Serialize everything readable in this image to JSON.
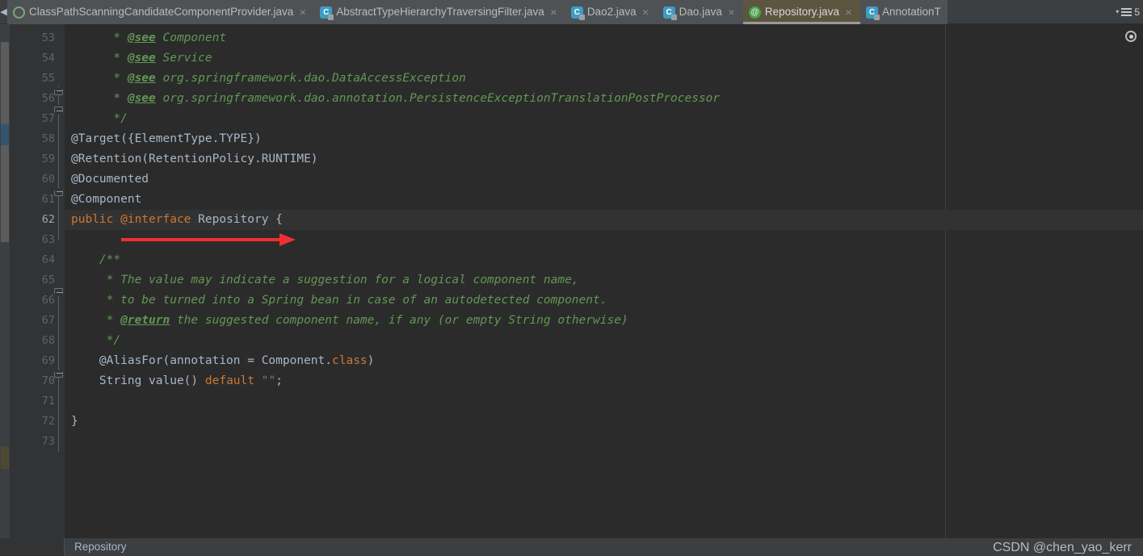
{
  "tabbar": {
    "scroll_left_icon": "chevron-left-icon",
    "tabs": [
      {
        "label": "ClassPathScanningCandidateComponentProvider.java",
        "icon": "class-file-icon",
        "icon_glyph": "",
        "close": "×",
        "active": false
      },
      {
        "label": "AbstractTypeHierarchyTraversingFilter.java",
        "icon": "class-file-icon",
        "icon_glyph": "C",
        "close": "×",
        "active": false
      },
      {
        "label": "Dao2.java",
        "icon": "class-file-icon",
        "icon_glyph": "C",
        "close": "×",
        "active": false
      },
      {
        "label": "Dao.java",
        "icon": "class-file-icon",
        "icon_glyph": "C",
        "close": "×",
        "active": false
      },
      {
        "label": "Repository.java",
        "icon": "annotation-file-icon",
        "icon_glyph": "@",
        "close": "×",
        "active": true
      },
      {
        "label": "AnnotationT",
        "icon": "class-file-icon",
        "icon_glyph": "C",
        "close": "",
        "active": false
      }
    ],
    "overflow": {
      "chevron": "▾",
      "count": "5"
    }
  },
  "editor": {
    "lines": [
      {
        "no": "53",
        "segs": [
          {
            "t": "      * ",
            "c": "c-doc"
          },
          {
            "t": "@see",
            "c": "c-tag"
          },
          {
            "t": " Component",
            "c": "c-doc"
          }
        ]
      },
      {
        "no": "54",
        "segs": [
          {
            "t": "      * ",
            "c": "c-doc"
          },
          {
            "t": "@see",
            "c": "c-tag"
          },
          {
            "t": " Service",
            "c": "c-doc"
          }
        ]
      },
      {
        "no": "55",
        "segs": [
          {
            "t": "      * ",
            "c": "c-doc"
          },
          {
            "t": "@see",
            "c": "c-tag"
          },
          {
            "t": " org.springframework.dao.DataAccessException",
            "c": "c-doc"
          }
        ]
      },
      {
        "no": "56",
        "segs": [
          {
            "t": "      * ",
            "c": "c-doc"
          },
          {
            "t": "@see",
            "c": "c-tag"
          },
          {
            "t": " org.springframework.dao.annotation.PersistenceExceptionTranslationPostProcessor",
            "c": "c-doc"
          }
        ]
      },
      {
        "no": "57",
        "segs": [
          {
            "t": "      */",
            "c": "c-doc"
          }
        ]
      },
      {
        "no": "58",
        "segs": [
          {
            "t": "@Target({ElementType.TYPE})",
            "c": "c-annon"
          }
        ]
      },
      {
        "no": "59",
        "segs": [
          {
            "t": "@Retention(RetentionPolicy.RUNTIME)",
            "c": "c-annon"
          }
        ]
      },
      {
        "no": "60",
        "segs": [
          {
            "t": "@Documented",
            "c": "c-annon"
          }
        ]
      },
      {
        "no": "61",
        "segs": [
          {
            "t": "@Component",
            "c": "c-annon"
          }
        ]
      },
      {
        "no": "62",
        "segs": [
          {
            "t": "public ",
            "c": "c-kw"
          },
          {
            "t": "@interface",
            "c": "c-kw"
          },
          {
            "t": " Repository {",
            "c": "c-txt"
          }
        ],
        "current": true
      },
      {
        "no": "63",
        "segs": []
      },
      {
        "no": "64",
        "segs": [
          {
            "t": "    /**",
            "c": "c-doc"
          }
        ]
      },
      {
        "no": "65",
        "segs": [
          {
            "t": "     * The value may indicate a suggestion for a logical component name,",
            "c": "c-doc"
          }
        ]
      },
      {
        "no": "66",
        "segs": [
          {
            "t": "     * to be turned into a Spring bean in case of an autodetected component.",
            "c": "c-doc"
          }
        ]
      },
      {
        "no": "67",
        "segs": [
          {
            "t": "     * ",
            "c": "c-doc"
          },
          {
            "t": "@return",
            "c": "c-tag"
          },
          {
            "t": " the suggested component name, if any (or empty String otherwise)",
            "c": "c-doc"
          }
        ]
      },
      {
        "no": "68",
        "segs": [
          {
            "t": "     */",
            "c": "c-doc"
          }
        ]
      },
      {
        "no": "69",
        "segs": [
          {
            "t": "    @AliasFor(annotation = Component.",
            "c": "c-txt"
          },
          {
            "t": "class",
            "c": "c-kw"
          },
          {
            "t": ")",
            "c": "c-txt"
          }
        ]
      },
      {
        "no": "70",
        "segs": [
          {
            "t": "    String value() ",
            "c": "c-txt"
          },
          {
            "t": "default",
            "c": "c-kw"
          },
          {
            "t": " ",
            "c": "c-txt"
          },
          {
            "t": "\"\"",
            "c": "c-str"
          },
          {
            "t": ";",
            "c": "c-txt"
          }
        ]
      },
      {
        "no": "71",
        "segs": []
      },
      {
        "no": "72",
        "segs": [
          {
            "t": "}",
            "c": "c-txt"
          }
        ]
      },
      {
        "no": "73",
        "segs": []
      }
    ],
    "annotation_arrow": "red-arrow-annotation",
    "inspection_widget": "inspection-eye-icon",
    "colors": {
      "background": "#2b2b2b",
      "gutter": "#313335",
      "current_line": "#323232",
      "doc_comment": "#629755",
      "keyword": "#cc7832",
      "string": "#6a8759",
      "identifier": "#a9b7c6",
      "arrow": "#f03030",
      "active_tab": "#5c5540"
    }
  },
  "breadcrumb": {
    "label": "Repository"
  },
  "watermark": {
    "text": "CSDN @chen_yao_kerr"
  }
}
